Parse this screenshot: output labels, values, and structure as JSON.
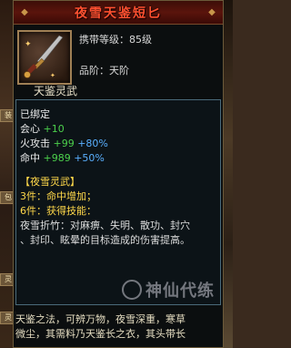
{
  "tooltip": {
    "title": "夜雪天鉴短匕",
    "carry_level": "携带等级：85级",
    "rank": "品阶：天阶",
    "series": "天鉴灵武",
    "bound": "已绑定",
    "stats": [
      {
        "name": "会心",
        "base": "+10",
        "bonus": ""
      },
      {
        "name": "火攻击",
        "base": "+99",
        "bonus": "+80%"
      },
      {
        "name": "命中",
        "base": "+989",
        "bonus": "+50%"
      }
    ],
    "set_name": "【夜雪灵武】",
    "set_3": "3件：命中增加；",
    "set_6": "6件：获得技能：",
    "skill_lines": [
      "夜雪折竹：对麻痹、失明、散功、封穴",
      "、封印、眩晕的目标造成的伤害提高。"
    ],
    "footer_lines": [
      "天鉴之法，可辨万物，夜雪深重，寒草",
      "微尘，其需料乃天鉴长之衣，其头带长"
    ]
  },
  "side_tabs": [
    "装",
    "包",
    "灵",
    "灵"
  ],
  "watermark": "神仙代练",
  "colors": {
    "title": "#ff5030",
    "green": "#4cd04c",
    "blue": "#4a8cff",
    "yellow": "#ffd84a"
  },
  "icon": "dagger-icon"
}
